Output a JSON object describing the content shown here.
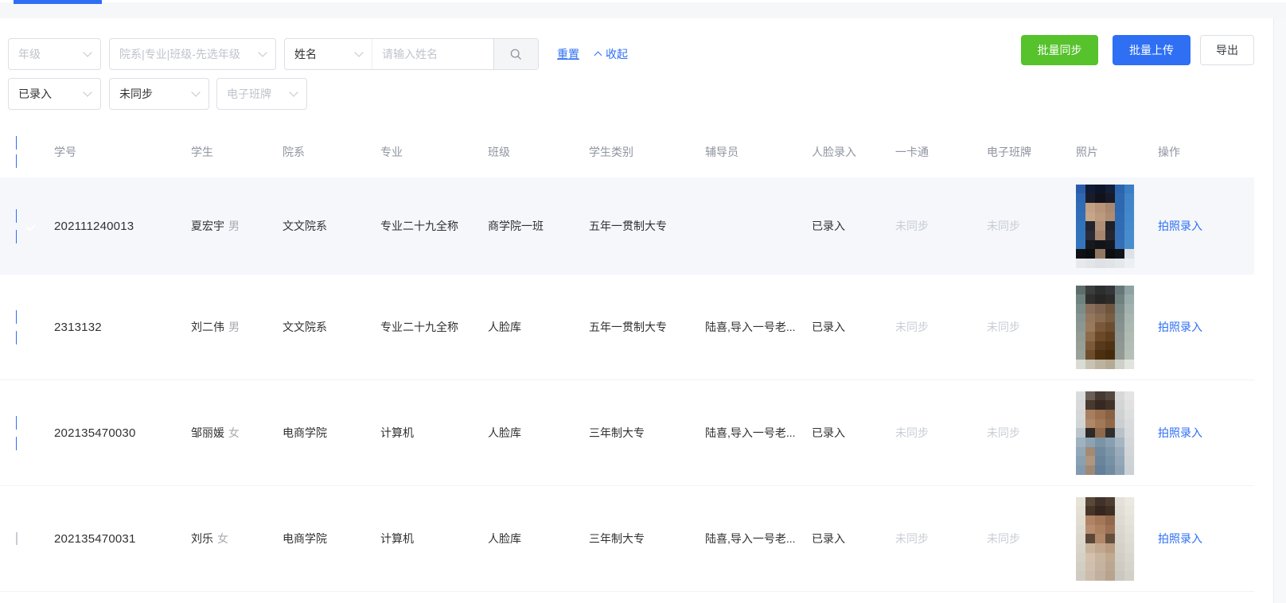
{
  "colors": {
    "accent": "#2e6ff4",
    "green": "#56c22c",
    "row_highlight": "#f5f7fb"
  },
  "filters": {
    "grade_placeholder": "年级",
    "dept_placeholder": "院系|专业|班级-先选年级",
    "name_select_value": "姓名",
    "name_input_placeholder": "请输入姓名",
    "entry_status_value": "已录入",
    "sync_status_value": "未同步",
    "eclass_placeholder": "电子班牌",
    "reset_label": "重置",
    "collapse_label": "收起"
  },
  "actions": {
    "batch_sync": "批量同步",
    "batch_upload": "批量上传",
    "export": "导出"
  },
  "table": {
    "columns": [
      "学号",
      "学生",
      "院系",
      "专业",
      "班级",
      "学生类别",
      "辅导员",
      "人脸录入",
      "一卡通",
      "电子班牌",
      "照片",
      "操作"
    ],
    "action_label": "拍照录入",
    "rows": [
      {
        "checked": true,
        "highlight": true,
        "id": "202111240013",
        "name": "夏宏宇",
        "gender": "男",
        "dept": "文文院系",
        "major": "专业二十九全称",
        "klass": "商学院一班",
        "type": "五年一贯制大专",
        "counselor": "",
        "face": "已录入",
        "card": "未同步",
        "eclass": "未同步",
        "photo": [
          [
            "#2a5da9",
            "#101c35",
            "#0c1628",
            "#13203a",
            "#2c64ad",
            "#3a7ec4"
          ],
          [
            "#2e68b2",
            "#1b1c2a",
            "#12121d",
            "#191a27",
            "#2e68af",
            "#4184c7"
          ],
          [
            "#2f6cb5",
            "#c2a084",
            "#b8957a",
            "#aa886e",
            "#2d68b0",
            "#4286c9"
          ],
          [
            "#306fb7",
            "#c6a589",
            "#bc9a7e",
            "#ae8d73",
            "#2f6ab2",
            "#4388ca"
          ],
          [
            "#3172b9",
            "#23242f",
            "#b18f77",
            "#1f2028",
            "#306cb4",
            "#458aca"
          ],
          [
            "#3274bb",
            "#2a2b35",
            "#a6866d",
            "#25262f",
            "#326db5",
            "#478ccc"
          ],
          [
            "#3376bd",
            "#18191f",
            "#13141a",
            "#16171e",
            "#346fb7",
            "#498dcd"
          ],
          [
            "#0f1116",
            "#0c0d11",
            "#907862",
            "#0d0e12",
            "#11141b",
            "#dce2e7"
          ],
          [
            "#e7eaed",
            "#e3e6e9",
            "#dee1e5",
            "#e1e4e7",
            "#e5e8eb",
            "#edf0f2"
          ]
        ]
      },
      {
        "checked": true,
        "highlight": false,
        "id": "2313132",
        "name": "刘二伟",
        "gender": "男",
        "dept": "文文院系",
        "major": "专业二十九全称",
        "klass": "人脸库",
        "type": "五年一贯制大专",
        "counselor": "陆喜,导入一号老...",
        "face": "已录入",
        "card": "未同步",
        "eclass": "未同步",
        "photo": [
          [
            "#5d6d69",
            "#3a3e3d",
            "#2d2e2e",
            "#343739",
            "#657779",
            "#8ea2a3"
          ],
          [
            "#6e827f",
            "#31302e",
            "#282625",
            "#2d2b2a",
            "#6f817e",
            "#9aaca9"
          ],
          [
            "#7c8c88",
            "#896e5b",
            "#7c624f",
            "#6e563e",
            "#7a8a87",
            "#a2b1ad"
          ],
          [
            "#869390",
            "#95775e",
            "#896b51",
            "#795d40",
            "#828e8a",
            "#a8b5b0"
          ],
          [
            "#8d9791",
            "#997a5d",
            "#7a593b",
            "#6c4d2f",
            "#879290",
            "#acb8b2"
          ],
          [
            "#939b94",
            "#8c6b4b",
            "#6b4929",
            "#5e3f1f",
            "#8c9591",
            "#b0bbb4"
          ],
          [
            "#979e96",
            "#7d5b39",
            "#59391b",
            "#4e3213",
            "#909893",
            "#b3bdb5"
          ],
          [
            "#9ba199",
            "#6e4d2d",
            "#4b2f0f",
            "#442a0d",
            "#939a94",
            "#b6bfb6"
          ],
          [
            "#d8dcd5",
            "#c8c2b3",
            "#bcb39f",
            "#b4aa94",
            "#ced1c8",
            "#e1e4dd"
          ]
        ]
      },
      {
        "checked": true,
        "highlight": false,
        "id": "202135470030",
        "name": "邹丽媛",
        "gender": "女",
        "dept": "电商学院",
        "major": "计算机",
        "klass": "人脸库",
        "type": "三年制大专",
        "counselor": "陆喜,导入一号老...",
        "face": "已录入",
        "card": "未同步",
        "eclass": "未同步",
        "photo": [
          [
            "#dbdddc",
            "#6a5e56",
            "#453a33",
            "#54473e",
            "#d7d9d8",
            "#e3e4e3"
          ],
          [
            "#d8dad9",
            "#493a30",
            "#352921",
            "#403229",
            "#d3d5d5",
            "#e0e1e0"
          ],
          [
            "#d5d7d7",
            "#a77e5f",
            "#996f4f",
            "#896143",
            "#cfd2d3",
            "#dddede"
          ],
          [
            "#d2d4d5",
            "#af8769",
            "#a27957",
            "#916849",
            "#cbcfd1",
            "#dadbdc"
          ],
          [
            "#bbc5cb",
            "#2d2926",
            "#8e694b",
            "#312f2d",
            "#b8c2c9",
            "#d7d9da"
          ],
          [
            "#9eb2c0",
            "#8da3b3",
            "#7a93a5",
            "#879fb0",
            "#a3b6c2",
            "#d4d7d9"
          ],
          [
            "#92a8b9",
            "#a48973",
            "#6f8a9f",
            "#7d96a8",
            "#9aacbb",
            "#d1d5d7"
          ],
          [
            "#89a1b4",
            "#b1967f",
            "#69859b",
            "#7791a4",
            "#93a7b7",
            "#ced3d6"
          ],
          [
            "#839bb0",
            "#9f8975",
            "#637f99",
            "#718ba0",
            "#8da2b3",
            "#cbd1d5"
          ]
        ]
      },
      {
        "checked": false,
        "highlight": false,
        "id": "202135470031",
        "name": "刘乐",
        "gender": "女",
        "dept": "电商学院",
        "major": "计算机",
        "klass": "人脸库",
        "type": "三年制大专",
        "counselor": "陆喜,导入一号老...",
        "face": "已录入",
        "card": "未同步",
        "eclass": "未同步",
        "photo": [
          [
            "#e7e3d9",
            "#594939",
            "#40322a",
            "#4d3e32",
            "#e3e0d7",
            "#ebe8df"
          ],
          [
            "#e4e0d6",
            "#463529",
            "#35271f",
            "#3f2f25",
            "#e0ddd4",
            "#e8e5dc"
          ],
          [
            "#e1ddd3",
            "#af8465",
            "#a47759",
            "#92694b",
            "#dddad1",
            "#e5e2d9"
          ],
          [
            "#dedad0",
            "#b88d6f",
            "#ac8162",
            "#9b7153",
            "#dad7ce",
            "#e2dfd6"
          ],
          [
            "#dbd7cd",
            "#5b4737",
            "#b18769",
            "#644f3d",
            "#d7d4cb",
            "#dfdcd3"
          ],
          [
            "#d8d4ca",
            "#cab39d",
            "#c2a78d",
            "#b89b81",
            "#d4d1c8",
            "#dcd9d0"
          ],
          [
            "#d5d1c7",
            "#d3c1ad",
            "#c9b59f",
            "#bfa98f",
            "#d1cec5",
            "#d9d6cd"
          ],
          [
            "#d2cec4",
            "#cfbfae",
            "#c5b2a0",
            "#bba692",
            "#cecbc2",
            "#d6d3ca"
          ],
          [
            "#cfcbc1",
            "#ccbcab",
            "#c2af9d",
            "#b8a38f",
            "#cbc8bf",
            "#d3d0c7"
          ]
        ]
      }
    ]
  }
}
